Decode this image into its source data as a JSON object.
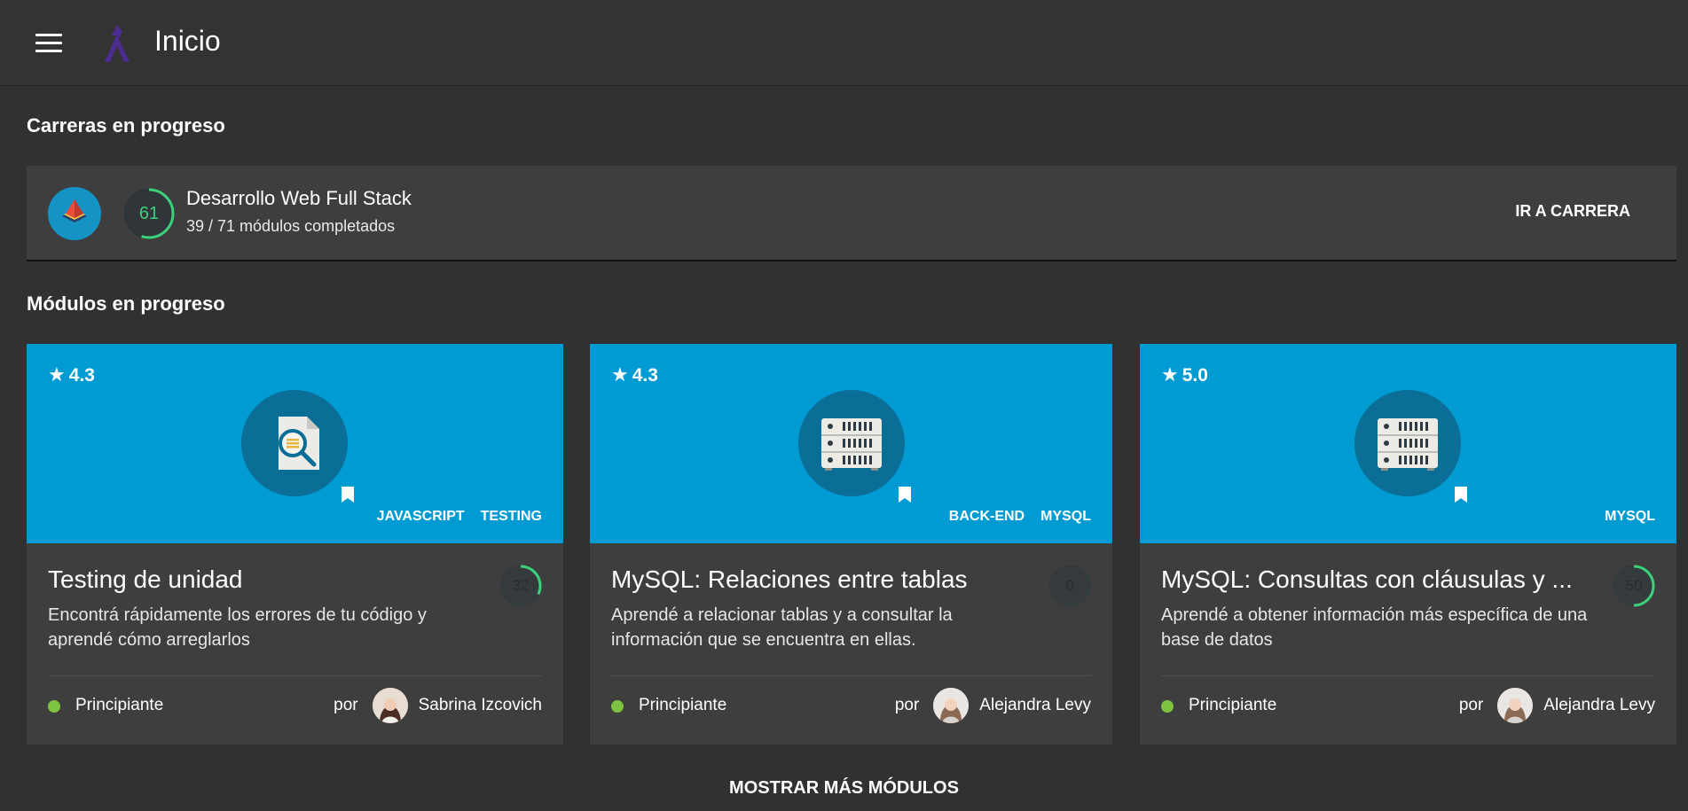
{
  "header": {
    "title": "Inicio"
  },
  "sections": {
    "careers": "Carreras en progreso",
    "modules": "Módulos en progreso"
  },
  "career": {
    "progress": "61",
    "progress_fraction": 0.55,
    "name": "Desarrollo Web Full Stack",
    "subtitle": "39 / 71 módulos completados",
    "action": "IR A CARRERA"
  },
  "modules": [
    {
      "rating": "4.3",
      "tags": [
        "JAVASCRIPT",
        "TESTING"
      ],
      "title": "Testing de unidad",
      "description": "Encontrá rápidamente los errores de tu código y aprendé cómo arreglarlos",
      "progress": "32",
      "progress_fraction": 0.32,
      "level": "Principiante",
      "by": "por",
      "author": "Sabrina Izcovich",
      "icon": "document-search-icon"
    },
    {
      "rating": "4.3",
      "tags": [
        "BACK-END",
        "MYSQL"
      ],
      "title": "MySQL: Relaciones entre tablas",
      "description": "Aprendé a relacionar tablas y a consultar la información que se encuentra en ellas.",
      "progress": "0",
      "progress_fraction": 0,
      "level": "Principiante",
      "by": "por",
      "author": "Alejandra Levy",
      "icon": "server-icon"
    },
    {
      "rating": "5.0",
      "tags": [
        "MYSQL"
      ],
      "title": "MySQL: Consultas con cláusulas y ...",
      "description": "Aprendé a obtener información más específica de una base de datos",
      "progress": "50",
      "progress_fraction": 0.5,
      "level": "Principiante",
      "by": "por",
      "author": "Alejandra Levy",
      "icon": "server-icon"
    }
  ],
  "more_button": "MOSTRAR MÁS MÓDULOS",
  "colors": {
    "accent": "#009bd3",
    "progress": "#3dd07b",
    "level": "#7ec242",
    "background": "#313131"
  }
}
